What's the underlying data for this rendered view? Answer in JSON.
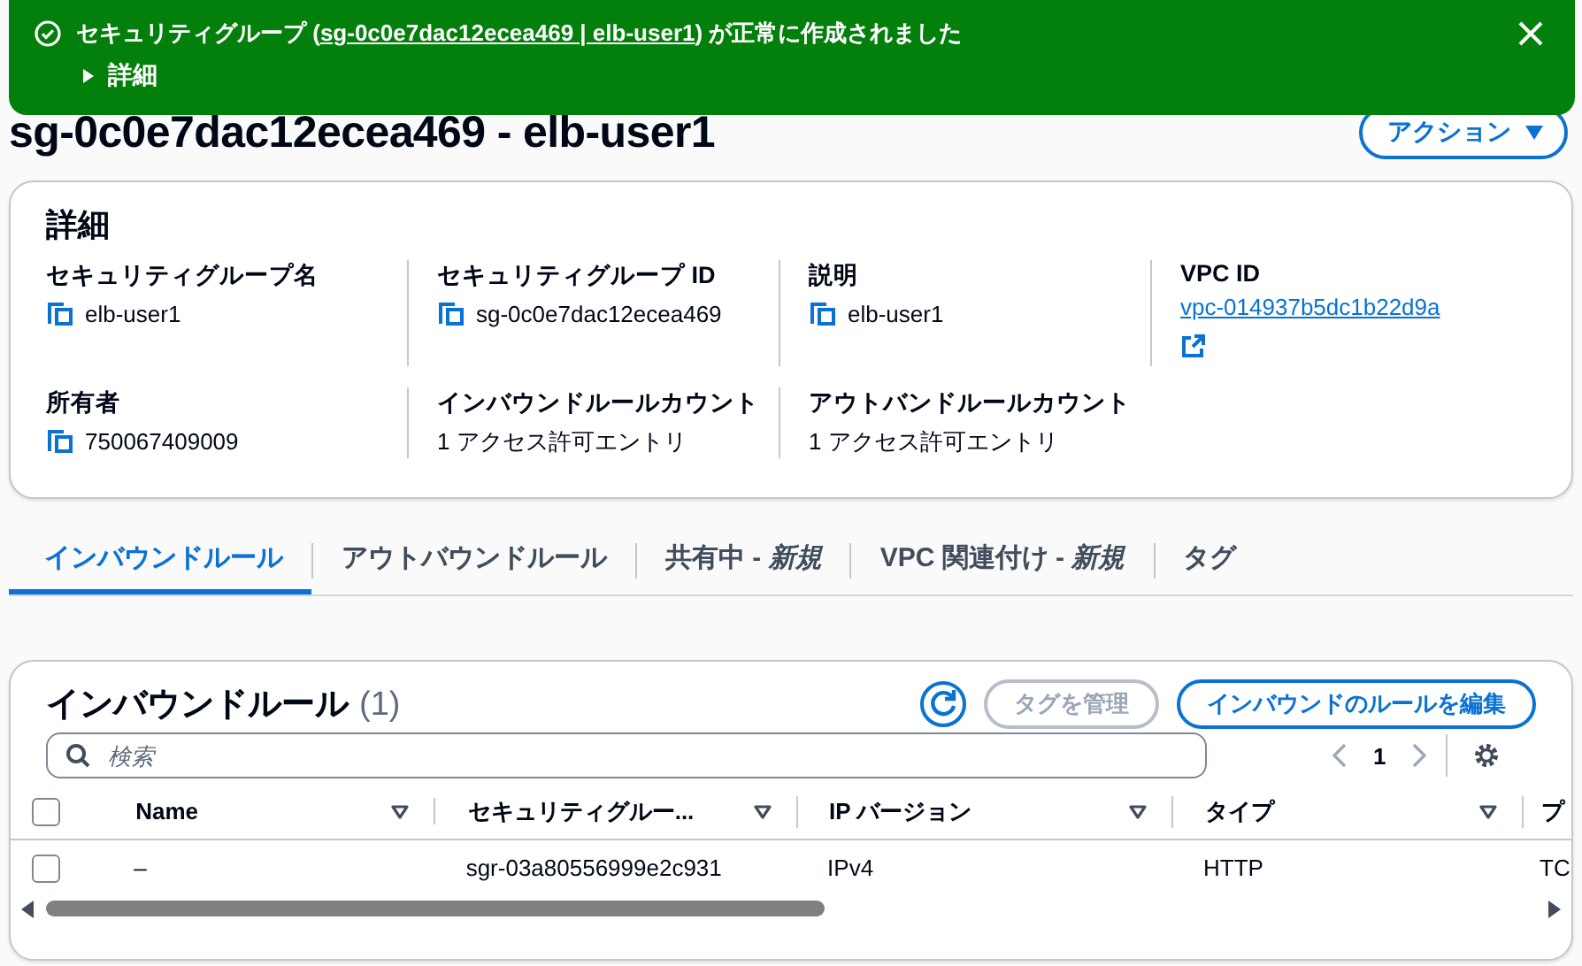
{
  "flash": {
    "before": "セキュリティグループ (",
    "link": "sg-0c0e7dac12ecea469 | elb-user1",
    "after": ") が正常に作成されました",
    "details_label": "詳細",
    "details_expanded": false
  },
  "page": {
    "title": "sg-0c0e7dac12ecea469 - elb-user1",
    "actions_button": "アクション"
  },
  "details": {
    "heading": "詳細",
    "fields": [
      {
        "label": "セキュリティグループ名",
        "value": "elb-user1",
        "kind": "copy"
      },
      {
        "label": "セキュリティグループ ID",
        "value": "sg-0c0e7dac12ecea469",
        "kind": "copy"
      },
      {
        "label": "説明",
        "value": "elb-user1",
        "kind": "copy"
      },
      {
        "label": "VPC ID",
        "value": "vpc-014937b5dc1b22d9a",
        "kind": "link"
      },
      {
        "label": "所有者",
        "value": "750067409009",
        "kind": "copy"
      },
      {
        "label": "インバウンドルールカウント",
        "value": "1 アクセス許可エントリ",
        "kind": "text"
      },
      {
        "label": "アウトバンドルールカウント",
        "value": "1 アクセス許可エントリ",
        "kind": "text"
      }
    ]
  },
  "tabs": [
    {
      "label": "インバウンドルール",
      "selected": true
    },
    {
      "label": "アウトバウンドルール",
      "selected": false
    },
    {
      "label": "共有中 - *新規*",
      "selected": false
    },
    {
      "label": "VPC 関連付け - *新規*",
      "selected": false
    },
    {
      "label": "タグ",
      "selected": false
    }
  ],
  "rules": {
    "heading": "インバウンドルール",
    "count": "(1)",
    "manage_tags": {
      "label": "タグを管理",
      "disabled": true
    },
    "edit_button": "インバウンドのルールを編集",
    "search": {
      "placeholder": "検索"
    },
    "page": "1",
    "all_checked": false,
    "columns": [
      {
        "label": "Name",
        "sortable": true
      },
      {
        "label": "セキュリティグルー...",
        "sortable": true
      },
      {
        "label": "IP バージョン",
        "sortable": true
      },
      {
        "label": "タイプ",
        "sortable": true
      },
      {
        "label": "プ",
        "sortable": false
      }
    ],
    "rows": [
      {
        "selected": false,
        "cells": [
          "–",
          "sgr-03a80556999e2c931",
          "IPv4",
          "HTTP",
          "TC"
        ]
      }
    ]
  }
}
